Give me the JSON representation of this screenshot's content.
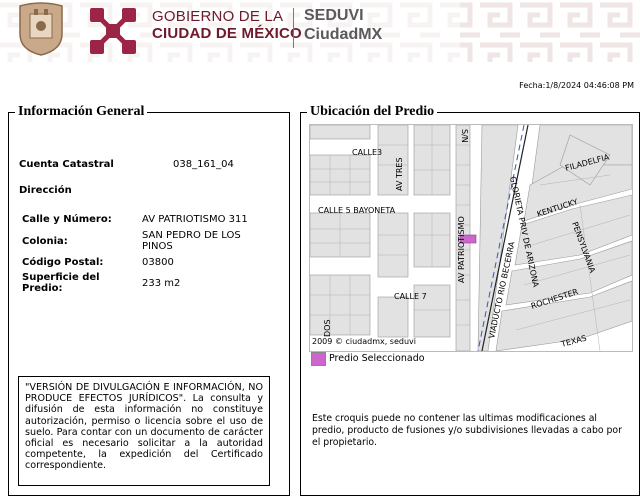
{
  "header": {
    "gov_line1": "GOBIERNO DE LA",
    "gov_line2": "CIUDAD DE MÉXICO",
    "agency_line1": "SEDUVI",
    "agency_line2": "CiudadMX"
  },
  "fecha": "Fecha:1/8/2024 04:46:08 PM",
  "info": {
    "legend": "Información General",
    "cuenta_label": "Cuenta Catastral",
    "cuenta_value": "038_161_04",
    "direccion_label": "Dirección",
    "calle_label": "Calle y Número:",
    "calle_value": "AV PATRIOTISMO 311",
    "colonia_label": "Colonia:",
    "colonia_value_1": "SAN PEDRO DE LOS",
    "colonia_value_2": "PINOS",
    "cp_label": "Código Postal:",
    "cp_value": "03800",
    "superficie_label_1": "Superficie del",
    "superficie_label_2": "Predio:",
    "superficie_value": "233 m2",
    "disclaimer": "\"VERSIÓN DE DIVULGACIÓN E INFORMACIÓN, NO PRODUCE EFECTOS JURÍDICOS\". La consulta y difusión de esta información no constituye autorización, permiso o licencia sobre el uso de suelo. Para contar con un documento de carácter oficial es necesario solicitar a la autoridad competente, la expedición del Certificado correspondiente."
  },
  "ubicacion": {
    "legend": "Ubicación del Predio",
    "map_credit": "2009 © ciudadmx, seduvi",
    "legend_label": "Predio Seleccionado",
    "note": "Este croquis puede no contener las ultimas modificaciones al predio, producto de fusiones y/o subdivisiones llevadas a cabo por el propietario.",
    "streets": {
      "calle3": "CALLE3",
      "av_tres": "AV TRES",
      "sn": "S/N",
      "calle5": "CALLE 5 BAYONETA",
      "patriotismo": "AV PATRIOTISMO",
      "calle7": "CALLE 7",
      "dos": "DOS",
      "viaducto": "VIADUCTO RIO BECERRA",
      "glorieta": "GLORIETA PRIV DE ARIZONA",
      "filadelfia": "FILADELFIA",
      "kentucky": "KENTUCKY",
      "pensylvania": "PENSYLVANIA",
      "rochester": "ROCHESTER",
      "texas": "TEXAS"
    },
    "colors": {
      "selected": "#cc66cc",
      "road_line": "#3355cc"
    }
  }
}
